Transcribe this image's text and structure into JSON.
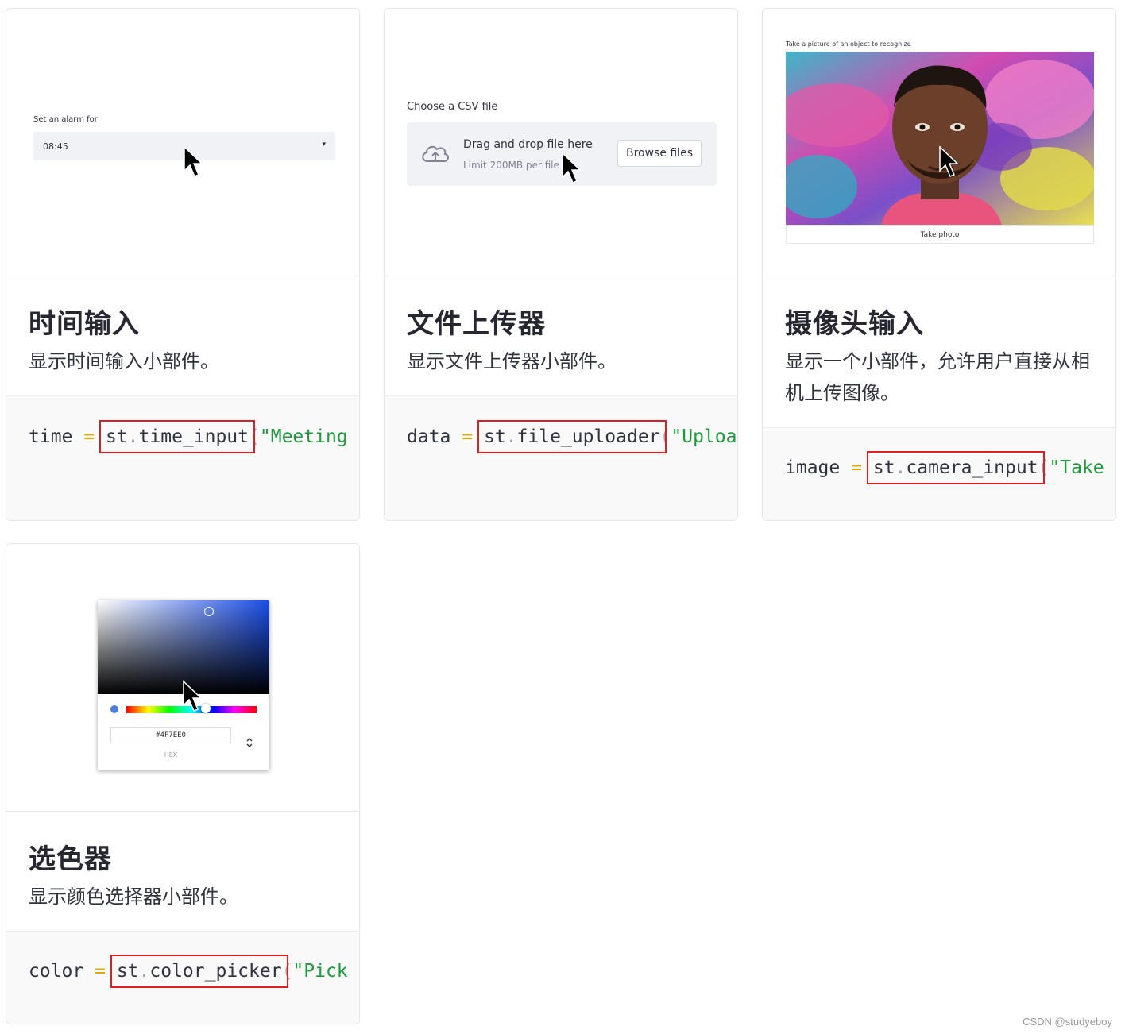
{
  "cards": [
    {
      "title": "时间输入",
      "description": "显示时间输入小部件。",
      "code": {
        "var": "time",
        "eq": "=",
        "mod": "st",
        "fn": "time_input",
        "paren": "(",
        "str": "\"Meeting"
      },
      "preview": {
        "label": "Set an alarm for",
        "value": "08:45",
        "caret": "▾"
      }
    },
    {
      "title": "文件上传器",
      "description": "显示文件上传器小部件。",
      "code": {
        "var": "data",
        "eq": "=",
        "mod": "st",
        "fn": "file_uploader",
        "paren": "(",
        "str": "\"Uploa"
      },
      "preview": {
        "label": "Choose a CSV file",
        "main": "Drag and drop file here",
        "sub": "Limit 200MB per file",
        "button": "Browse files"
      }
    },
    {
      "title": "摄像头输入",
      "description": "显示一个小部件，允许用户直接从相机上传图像。",
      "code": {
        "var": "image",
        "eq": "=",
        "mod": "st",
        "fn": "camera_input",
        "paren": "(",
        "str": "\"Take"
      },
      "preview": {
        "label": "Take a picture of an object to recognize",
        "button": "Take photo"
      }
    },
    {
      "title": "选色器",
      "description": "显示颜色选择器小部件。",
      "code": {
        "var": "color",
        "eq": "=",
        "mod": "st",
        "fn": "color_picker",
        "paren": "(",
        "str": "\"Pick"
      },
      "preview": {
        "hex": "#4F7EE0",
        "hex_label": "HEX",
        "toggle": "⌃⌄"
      }
    }
  ],
  "watermark": "CSDN @studyeboy",
  "colors": {
    "highlight": "#e02020",
    "string": "#1d9a3a",
    "operator": "#e0a800",
    "picked": "#4f7ee0"
  }
}
